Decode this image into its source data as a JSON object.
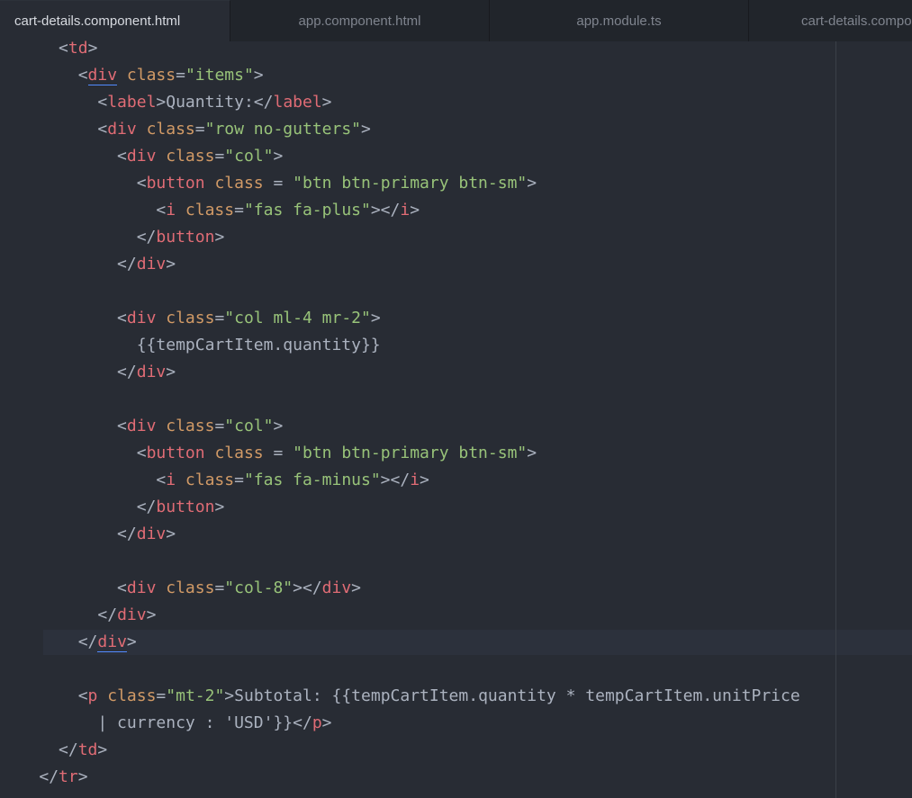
{
  "tabs": [
    {
      "label": "cart-details.component.html",
      "active": true
    },
    {
      "label": "app.component.html",
      "active": false
    },
    {
      "label": "app.module.ts",
      "active": false
    },
    {
      "label": "cart-details.compo",
      "active": false
    }
  ],
  "code": {
    "lines": [
      {
        "indent": "      ",
        "tokens": [
          [
            "punct",
            "<"
          ],
          [
            "tag",
            "td"
          ],
          [
            "punct",
            ">"
          ]
        ]
      },
      {
        "indent": "        ",
        "tokens": [
          [
            "punct",
            "<"
          ],
          [
            "tag",
            "div"
          ],
          [
            "txt",
            " "
          ],
          [
            "attr",
            "class"
          ],
          [
            "punct",
            "="
          ],
          [
            "str",
            "\"items\""
          ],
          [
            "punct",
            ">"
          ]
        ],
        "match": 1
      },
      {
        "indent": "          ",
        "tokens": [
          [
            "punct",
            "<"
          ],
          [
            "tag",
            "label"
          ],
          [
            "punct",
            ">"
          ],
          [
            "txt",
            "Quantity:"
          ],
          [
            "punct",
            "</"
          ],
          [
            "tag",
            "label"
          ],
          [
            "punct",
            ">"
          ]
        ]
      },
      {
        "indent": "          ",
        "tokens": [
          [
            "punct",
            "<"
          ],
          [
            "tag",
            "div"
          ],
          [
            "txt",
            " "
          ],
          [
            "attr",
            "class"
          ],
          [
            "punct",
            "="
          ],
          [
            "str",
            "\"row no-gutters\""
          ],
          [
            "punct",
            ">"
          ]
        ]
      },
      {
        "indent": "            ",
        "tokens": [
          [
            "punct",
            "<"
          ],
          [
            "tag",
            "div"
          ],
          [
            "txt",
            " "
          ],
          [
            "attr",
            "class"
          ],
          [
            "punct",
            "="
          ],
          [
            "str",
            "\"col\""
          ],
          [
            "punct",
            ">"
          ]
        ]
      },
      {
        "indent": "              ",
        "tokens": [
          [
            "punct",
            "<"
          ],
          [
            "tag",
            "button"
          ],
          [
            "txt",
            " "
          ],
          [
            "attr",
            "class"
          ],
          [
            "txt",
            " "
          ],
          [
            "punct",
            "="
          ],
          [
            "txt",
            " "
          ],
          [
            "str",
            "\"btn btn-primary btn-sm\""
          ],
          [
            "punct",
            ">"
          ]
        ]
      },
      {
        "indent": "                ",
        "tokens": [
          [
            "punct",
            "<"
          ],
          [
            "tag",
            "i"
          ],
          [
            "txt",
            " "
          ],
          [
            "attr",
            "class"
          ],
          [
            "punct",
            "="
          ],
          [
            "str",
            "\"fas fa-plus\""
          ],
          [
            "punct",
            "></"
          ],
          [
            "tag",
            "i"
          ],
          [
            "punct",
            ">"
          ]
        ]
      },
      {
        "indent": "              ",
        "tokens": [
          [
            "punct",
            "</"
          ],
          [
            "tag",
            "button"
          ],
          [
            "punct",
            ">"
          ]
        ]
      },
      {
        "indent": "            ",
        "tokens": [
          [
            "punct",
            "</"
          ],
          [
            "tag",
            "div"
          ],
          [
            "punct",
            ">"
          ]
        ]
      },
      {
        "indent": "",
        "tokens": []
      },
      {
        "indent": "            ",
        "tokens": [
          [
            "punct",
            "<"
          ],
          [
            "tag",
            "div"
          ],
          [
            "txt",
            " "
          ],
          [
            "attr",
            "class"
          ],
          [
            "punct",
            "="
          ],
          [
            "str",
            "\"col ml-4 mr-2\""
          ],
          [
            "punct",
            ">"
          ]
        ]
      },
      {
        "indent": "              ",
        "tokens": [
          [
            "txt",
            "{{tempCartItem.quantity}}"
          ]
        ]
      },
      {
        "indent": "            ",
        "tokens": [
          [
            "punct",
            "</"
          ],
          [
            "tag",
            "div"
          ],
          [
            "punct",
            ">"
          ]
        ]
      },
      {
        "indent": "",
        "tokens": []
      },
      {
        "indent": "            ",
        "tokens": [
          [
            "punct",
            "<"
          ],
          [
            "tag",
            "div"
          ],
          [
            "txt",
            " "
          ],
          [
            "attr",
            "class"
          ],
          [
            "punct",
            "="
          ],
          [
            "str",
            "\"col\""
          ],
          [
            "punct",
            ">"
          ]
        ]
      },
      {
        "indent": "              ",
        "tokens": [
          [
            "punct",
            "<"
          ],
          [
            "tag",
            "button"
          ],
          [
            "txt",
            " "
          ],
          [
            "attr",
            "class"
          ],
          [
            "txt",
            " "
          ],
          [
            "punct",
            "="
          ],
          [
            "txt",
            " "
          ],
          [
            "str",
            "\"btn btn-primary btn-sm\""
          ],
          [
            "punct",
            ">"
          ]
        ]
      },
      {
        "indent": "                ",
        "tokens": [
          [
            "punct",
            "<"
          ],
          [
            "tag",
            "i"
          ],
          [
            "txt",
            " "
          ],
          [
            "attr",
            "class"
          ],
          [
            "punct",
            "="
          ],
          [
            "str",
            "\"fas fa-minus\""
          ],
          [
            "punct",
            "></"
          ],
          [
            "tag",
            "i"
          ],
          [
            "punct",
            ">"
          ]
        ]
      },
      {
        "indent": "              ",
        "tokens": [
          [
            "punct",
            "</"
          ],
          [
            "tag",
            "button"
          ],
          [
            "punct",
            ">"
          ]
        ]
      },
      {
        "indent": "            ",
        "tokens": [
          [
            "punct",
            "</"
          ],
          [
            "tag",
            "div"
          ],
          [
            "punct",
            ">"
          ]
        ]
      },
      {
        "indent": "",
        "tokens": []
      },
      {
        "indent": "            ",
        "tokens": [
          [
            "punct",
            "<"
          ],
          [
            "tag",
            "div"
          ],
          [
            "txt",
            " "
          ],
          [
            "attr",
            "class"
          ],
          [
            "punct",
            "="
          ],
          [
            "str",
            "\"col-8\""
          ],
          [
            "punct",
            "></"
          ],
          [
            "tag",
            "div"
          ],
          [
            "punct",
            ">"
          ]
        ]
      },
      {
        "indent": "          ",
        "tokens": [
          [
            "punct",
            "</"
          ],
          [
            "tag",
            "div"
          ],
          [
            "punct",
            ">"
          ]
        ]
      },
      {
        "indent": "        ",
        "tokens": [
          [
            "punct",
            "</"
          ],
          [
            "tag",
            "div"
          ],
          [
            "punct",
            ">"
          ]
        ],
        "current": true,
        "match": 1
      },
      {
        "indent": "",
        "tokens": []
      },
      {
        "indent": "        ",
        "tokens": [
          [
            "punct",
            "<"
          ],
          [
            "tag",
            "p"
          ],
          [
            "txt",
            " "
          ],
          [
            "attr",
            "class"
          ],
          [
            "punct",
            "="
          ],
          [
            "str",
            "\"mt-2\""
          ],
          [
            "punct",
            ">"
          ],
          [
            "txt",
            "Subtotal: {{tempCartItem.quantity * tempCartItem.unitPrice"
          ]
        ]
      },
      {
        "indent": "          ",
        "tokens": [
          [
            "txt",
            "| currency : 'USD'}}"
          ],
          [
            "punct",
            "</"
          ],
          [
            "tag",
            "p"
          ],
          [
            "punct",
            ">"
          ]
        ]
      },
      {
        "indent": "      ",
        "tokens": [
          [
            "punct",
            "</"
          ],
          [
            "tag",
            "td"
          ],
          [
            "punct",
            ">"
          ]
        ]
      },
      {
        "indent": "    ",
        "tokens": [
          [
            "punct",
            "</"
          ],
          [
            "tag",
            "tr"
          ],
          [
            "punct",
            ">"
          ]
        ]
      }
    ]
  },
  "colors": {
    "background": "#282c34",
    "tag": "#e06c75",
    "attribute": "#d19a66",
    "string": "#98c379",
    "text": "#abb2bf"
  }
}
